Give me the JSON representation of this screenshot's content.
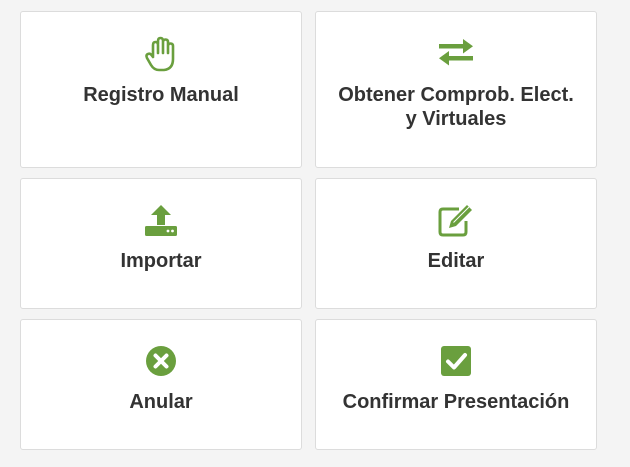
{
  "colors": {
    "accent": "#6a9f3e",
    "text": "#333333",
    "card_bg": "#ffffff",
    "card_border": "#dcdcdc",
    "page_bg": "#f4f4f4"
  },
  "cards": [
    {
      "label": "Registro Manual",
      "icon": "hand-icon"
    },
    {
      "label": "Obtener Comprob. Elect.\ny Virtuales",
      "icon": "exchange-arrows-icon"
    },
    {
      "label": "Importar",
      "icon": "upload-icon"
    },
    {
      "label": "Editar",
      "icon": "edit-icon"
    },
    {
      "label": "Anular",
      "icon": "cancel-circle-icon"
    },
    {
      "label": "Confirmar Presentación",
      "icon": "check-square-icon"
    }
  ]
}
